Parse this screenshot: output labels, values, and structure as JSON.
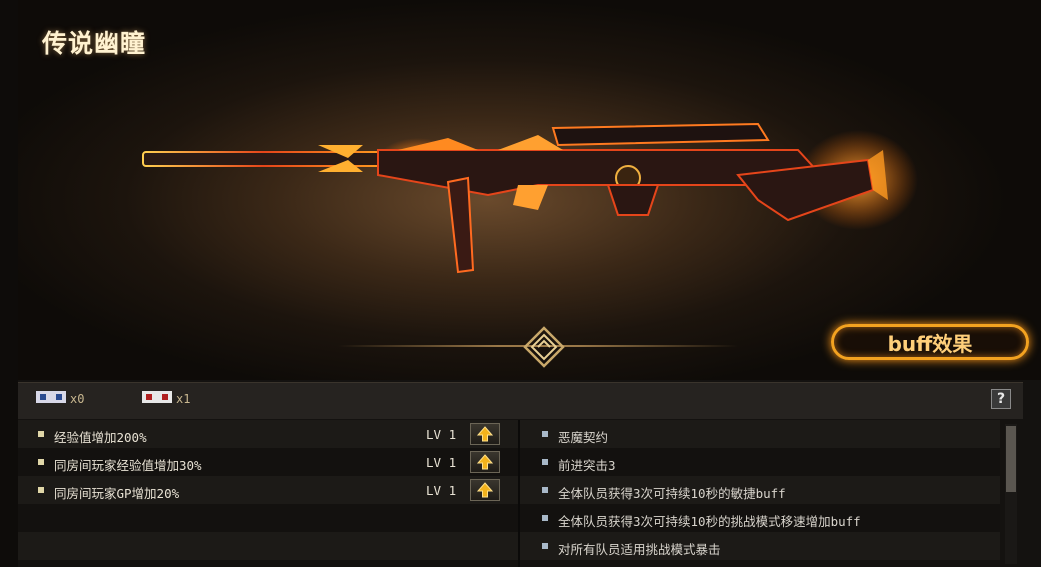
{
  "title": "传说幽瞳",
  "buff_button_label": "buff效果",
  "inventory": [
    {
      "icon": "badge-card-icon",
      "count": "x0"
    },
    {
      "icon": "badge-card-icon",
      "count": "x1"
    }
  ],
  "help_label": "?",
  "upgrades": [
    {
      "label": "经验值增加200%",
      "level": "LV 1"
    },
    {
      "label": "同房间玩家经验值增加30%",
      "level": "LV 1"
    },
    {
      "label": "同房间玩家GP增加20%",
      "level": "LV 1"
    }
  ],
  "buffs": [
    "恶魔契约",
    "前进突击3",
    "全体队员获得3次可持续10秒的敏捷buff",
    "全体队员获得3次可持续10秒的挑战模式移速增加buff",
    "对所有队员适用挑战模式暴击"
  ],
  "colors": {
    "accent": "#f3a220",
    "bullet": "#e0d7a8",
    "panel": "#262320"
  }
}
